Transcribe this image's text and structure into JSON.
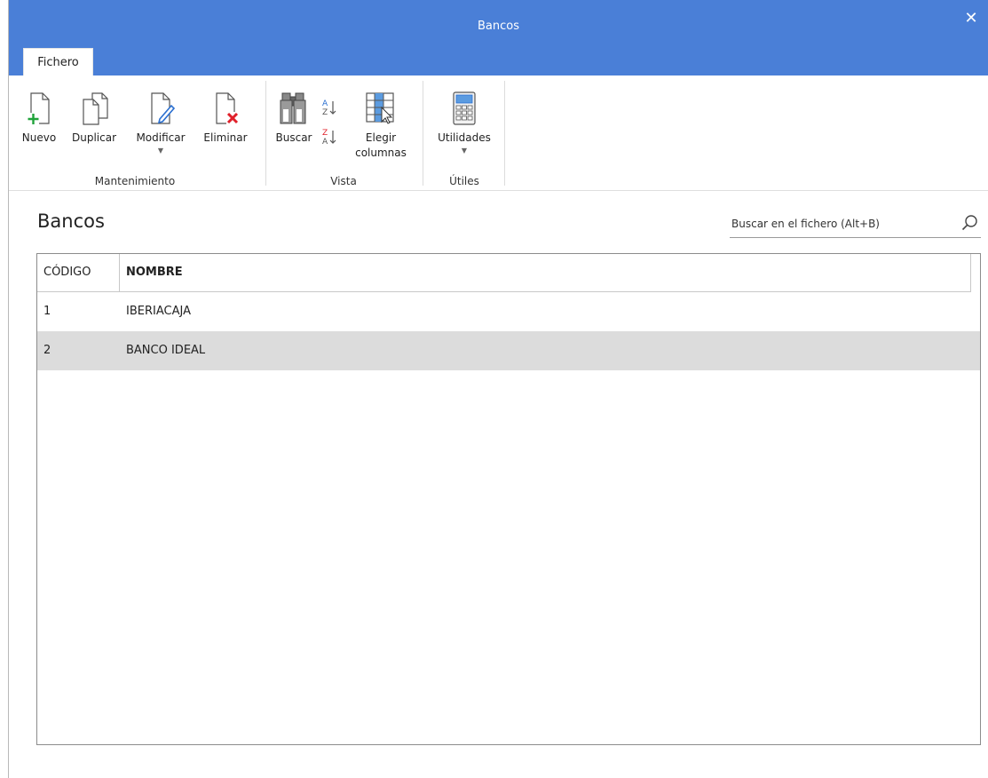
{
  "window": {
    "title": "Bancos",
    "close_label": "✕"
  },
  "ribbon": {
    "tab": "Fichero",
    "buttons": {
      "nuevo": "Nuevo",
      "duplicar": "Duplicar",
      "modificar": "Modificar",
      "eliminar": "Eliminar",
      "buscar": "Buscar",
      "elegir_line1": "Elegir",
      "elegir_line2": "columnas",
      "utilidades": "Utilidades"
    },
    "groups": {
      "mantenimiento": "Mantenimiento",
      "vista": "Vista",
      "utiles": "Útiles"
    }
  },
  "main": {
    "title": "Bancos",
    "search": {
      "placeholder": "Buscar en el fichero (Alt+B)"
    },
    "grid": {
      "columns": [
        "CÓDIGO",
        "NOMBRE"
      ],
      "rows": [
        {
          "codigo": "1",
          "nombre": "IBERIACAJA",
          "selected": false
        },
        {
          "codigo": "2",
          "nombre": "BANCO IDEAL",
          "selected": true
        }
      ]
    }
  },
  "colors": {
    "titlebar": "#4a7fd7",
    "add_green": "#1fa33a",
    "delete_red": "#e0202a",
    "edit_blue": "#2a6fd0",
    "selected_row": "#dcdcdc"
  },
  "icons": [
    "new-document-icon",
    "duplicate-icon",
    "edit-document-icon",
    "delete-document-icon",
    "binoculars-icon",
    "sort-ascending-icon",
    "sort-descending-icon",
    "choose-columns-icon",
    "calculator-icon",
    "search-icon",
    "close-icon"
  ]
}
